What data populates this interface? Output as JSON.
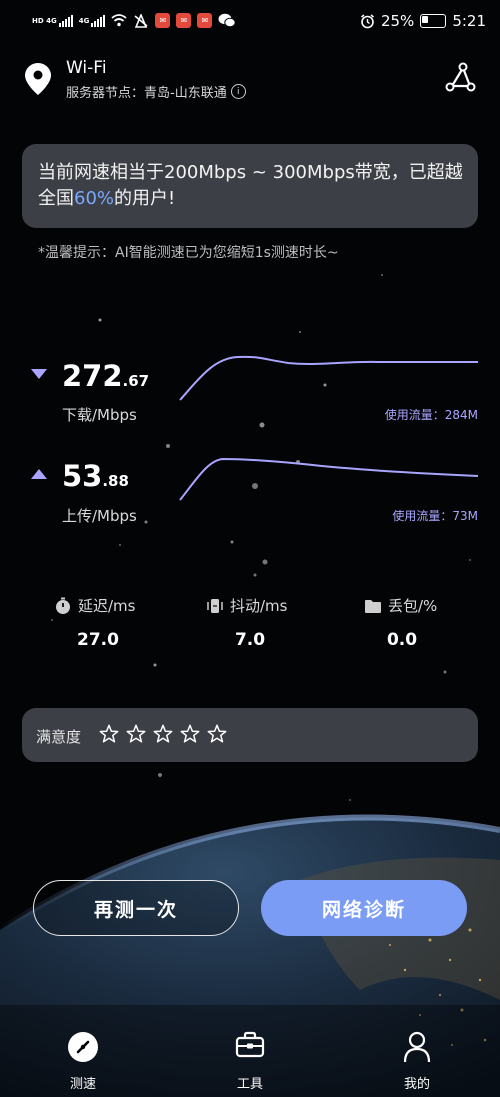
{
  "status_bar": {
    "sim1_label": "HD 4G",
    "sim2_label": "4G",
    "battery_percent": "25%",
    "time": "5:21"
  },
  "header": {
    "network_name": "Wi-Fi",
    "server_label": "服务器节点：青岛-山东联通",
    "info_icon": "info-icon",
    "share_icon": "share-icon"
  },
  "banner": {
    "text_before": "当前网速相当于200Mbps ~ 300Mbps带宽，已超越全国",
    "percent": "60%",
    "text_after": "的用户!"
  },
  "tip": "*温馨提示：AI智能测速已为您缩短1s测速时长~",
  "download": {
    "value_int": "272",
    "value_dec": ".67",
    "unit": "下载/Mbps",
    "traffic": "使用流量：284M"
  },
  "upload": {
    "value_int": "53",
    "value_dec": ".88",
    "unit": "上传/Mbps",
    "traffic": "使用流量：73M"
  },
  "metrics": [
    {
      "label": "延迟/ms",
      "value": "27.0",
      "icon": "stopwatch-icon"
    },
    {
      "label": "抖动/ms",
      "value": "7.0",
      "icon": "jitter-icon"
    },
    {
      "label": "丢包/%",
      "value": "0.0",
      "icon": "folder-icon"
    }
  ],
  "satisfaction": {
    "label": "满意度",
    "rating": 0,
    "max_rating": 5
  },
  "buttons": {
    "retest": "再测一次",
    "diagnose": "网络诊断"
  },
  "tabs": [
    {
      "label": "测速",
      "icon": "speedometer-icon"
    },
    {
      "label": "工具",
      "icon": "toolbox-icon"
    },
    {
      "label": "我的",
      "icon": "person-icon"
    }
  ],
  "colors": {
    "accent": "#a9a5ff",
    "highlight": "#7aa8ff",
    "button_primary": "#7b9cf5",
    "card_bg": "#3c3f46"
  }
}
